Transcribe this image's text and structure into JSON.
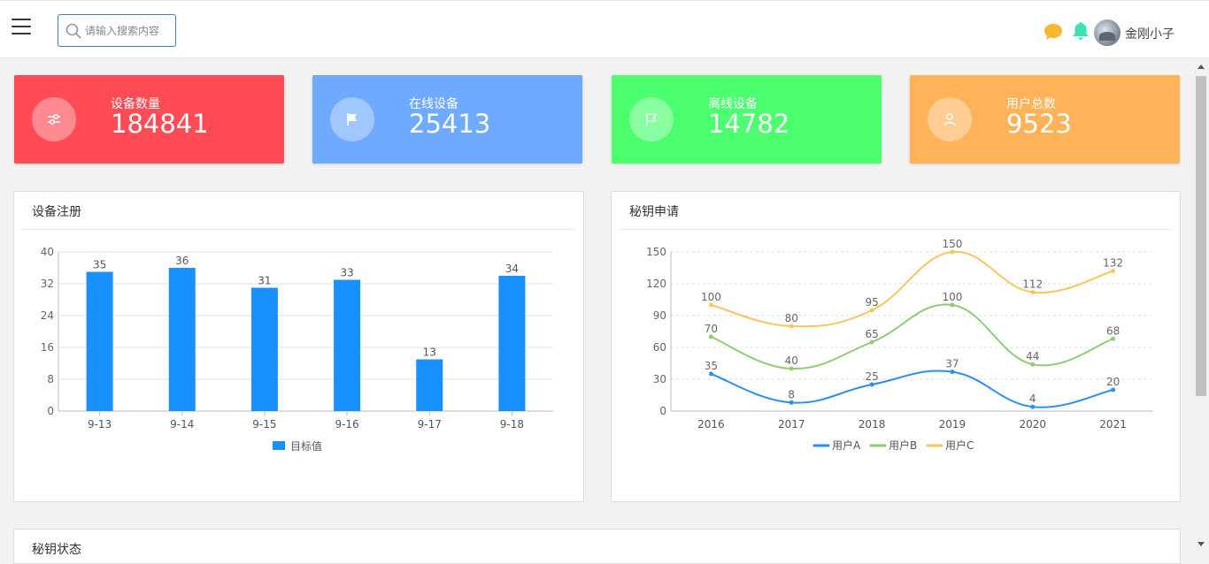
{
  "header": {
    "search_placeholder": "请输入搜索内容",
    "user_name": "金刚小子",
    "icons": [
      "menu-icon",
      "search-icon",
      "chat-icon",
      "bell-icon",
      "avatar"
    ]
  },
  "stats": [
    {
      "label": "设备数量",
      "value": "184841",
      "color": "#ff4b55",
      "icon": "sliders-icon"
    },
    {
      "label": "在线设备",
      "value": "25413",
      "color": "#6eaaff",
      "icon": "flag-icon"
    },
    {
      "label": "离线设备",
      "value": "14782",
      "color": "#4cff6f",
      "icon": "flag-outline-icon"
    },
    {
      "label": "用户总数",
      "value": "9523",
      "color": "#ffb359",
      "icon": "user-icon"
    }
  ],
  "panels": {
    "device_register": {
      "title": "设备注册"
    },
    "key_apply": {
      "title": "秘钥申请"
    },
    "key_status": {
      "title": "秘钥状态"
    }
  },
  "chart_data": [
    {
      "type": "bar",
      "categories": [
        "9-13",
        "9-14",
        "9-15",
        "9-16",
        "9-17",
        "9-18"
      ],
      "series": [
        {
          "name": "目标值",
          "values": [
            35,
            36,
            31,
            33,
            13,
            34
          ],
          "color": "#1890ff"
        }
      ],
      "yticks": [
        0,
        8,
        16,
        24,
        32,
        40
      ],
      "ylim": [
        0,
        40
      ],
      "legend": "bottom",
      "grid": true
    },
    {
      "type": "line",
      "categories": [
        "2016",
        "2017",
        "2018",
        "2019",
        "2020",
        "2021"
      ],
      "series": [
        {
          "name": "用户A",
          "values": [
            35,
            8,
            25,
            37,
            4,
            20
          ],
          "color": "#2a8ff0"
        },
        {
          "name": "用户B",
          "values": [
            70,
            40,
            65,
            100,
            44,
            68
          ],
          "color": "#91cc75"
        },
        {
          "name": "用户C",
          "values": [
            100,
            80,
            95,
            150,
            112,
            132
          ],
          "color": "#f2c85b"
        }
      ],
      "yticks": [
        0,
        30,
        60,
        90,
        120,
        150
      ],
      "ylim": [
        0,
        150
      ],
      "legend": "bottom",
      "grid": true
    }
  ]
}
